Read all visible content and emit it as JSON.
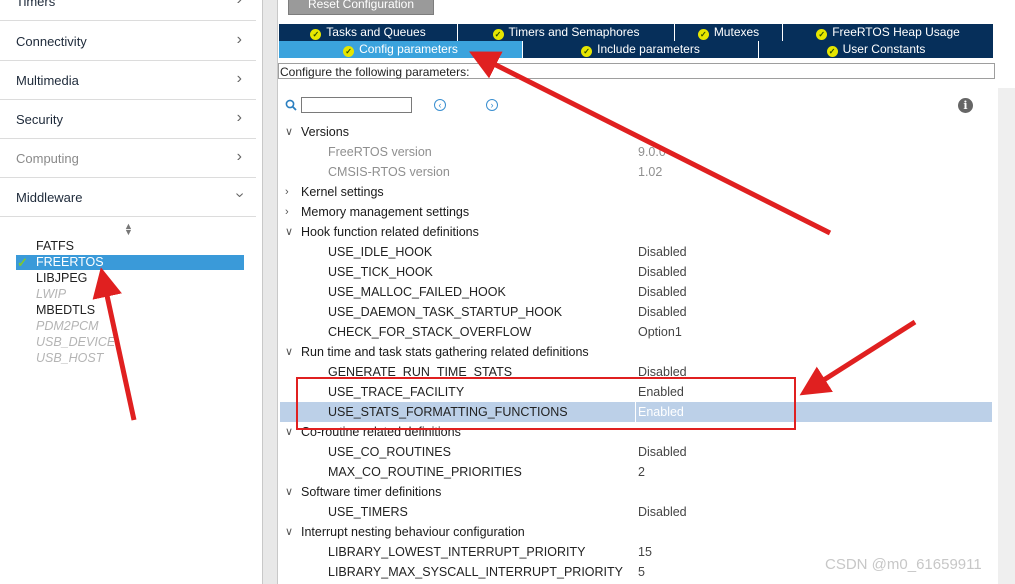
{
  "sidebar": {
    "categories": [
      {
        "label": "Timers",
        "disabled": false
      },
      {
        "label": "Connectivity",
        "disabled": false
      },
      {
        "label": "Multimedia",
        "disabled": false
      },
      {
        "label": "Security",
        "disabled": false
      },
      {
        "label": "Computing",
        "disabled": true
      },
      {
        "label": "Middleware",
        "disabled": false
      }
    ],
    "middleware_items": [
      {
        "label": "FATFS",
        "state": "normal"
      },
      {
        "label": "FREERTOS",
        "state": "selected"
      },
      {
        "label": "LIBJPEG",
        "state": "normal"
      },
      {
        "label": "LWIP",
        "state": "disabled"
      },
      {
        "label": "MBEDTLS",
        "state": "normal"
      },
      {
        "label": "PDM2PCM",
        "state": "disabled"
      },
      {
        "label": "USB_DEVICE",
        "state": "disabled"
      },
      {
        "label": "USB_HOST",
        "state": "disabled"
      }
    ]
  },
  "toolbar": {
    "reset_label": "Reset Configuration"
  },
  "tabs": {
    "row1": [
      "Tasks and Queues",
      "Timers and Semaphores",
      "Mutexes",
      "FreeRTOS Heap Usage"
    ],
    "row2": [
      "Config parameters",
      "Include parameters",
      "User Constants"
    ],
    "active": "Config parameters"
  },
  "hint": "Configure the following parameters:",
  "search": {
    "value": ""
  },
  "tree": [
    {
      "type": "group",
      "label": "Versions",
      "expanded": true
    },
    {
      "type": "param",
      "label": "FreeRTOS version",
      "value": "9.0.0",
      "readonly": true
    },
    {
      "type": "param",
      "label": "CMSIS-RTOS version",
      "value": "1.02",
      "readonly": true
    },
    {
      "type": "group",
      "label": "Kernel settings",
      "expanded": false
    },
    {
      "type": "group",
      "label": "Memory management settings",
      "expanded": false
    },
    {
      "type": "group",
      "label": "Hook function related definitions",
      "expanded": true
    },
    {
      "type": "param",
      "label": "USE_IDLE_HOOK",
      "value": "Disabled"
    },
    {
      "type": "param",
      "label": "USE_TICK_HOOK",
      "value": "Disabled"
    },
    {
      "type": "param",
      "label": "USE_MALLOC_FAILED_HOOK",
      "value": "Disabled"
    },
    {
      "type": "param",
      "label": "USE_DAEMON_TASK_STARTUP_HOOK",
      "value": "Disabled"
    },
    {
      "type": "param",
      "label": "CHECK_FOR_STACK_OVERFLOW",
      "value": "Option1"
    },
    {
      "type": "group",
      "label": "Run time and task stats gathering related definitions",
      "expanded": true
    },
    {
      "type": "param",
      "label": "GENERATE_RUN_TIME_STATS",
      "value": "Disabled"
    },
    {
      "type": "param",
      "label": "USE_TRACE_FACILITY",
      "value": "Enabled"
    },
    {
      "type": "param",
      "label": "USE_STATS_FORMATTING_FUNCTIONS",
      "value": "Enabled",
      "highlight": true
    },
    {
      "type": "group",
      "label": "Co-routine related definitions",
      "expanded": true
    },
    {
      "type": "param",
      "label": "USE_CO_ROUTINES",
      "value": "Disabled"
    },
    {
      "type": "param",
      "label": "MAX_CO_ROUTINE_PRIORITIES",
      "value": "2"
    },
    {
      "type": "group",
      "label": "Software timer definitions",
      "expanded": true
    },
    {
      "type": "param",
      "label": "USE_TIMERS",
      "value": "Disabled"
    },
    {
      "type": "group",
      "label": "Interrupt nesting behaviour configuration",
      "expanded": true
    },
    {
      "type": "param",
      "label": "LIBRARY_LOWEST_INTERRUPT_PRIORITY",
      "value": "15"
    },
    {
      "type": "param",
      "label": "LIBRARY_MAX_SYSCALL_INTERRUPT_PRIORITY",
      "value": "5"
    }
  ],
  "watermark": "CSDN @m0_61659911",
  "colors": {
    "tab_bg": "#062f5a",
    "tab_active": "#3ba3dd",
    "selected_bg": "#3a9ad9",
    "annotation_red": "#e02020"
  },
  "icons": {
    "search": "magnifier-icon",
    "prev": "chevron-left-circle-icon",
    "next": "chevron-right-circle-icon",
    "info": "info-icon",
    "check": "checkmark-icon"
  }
}
